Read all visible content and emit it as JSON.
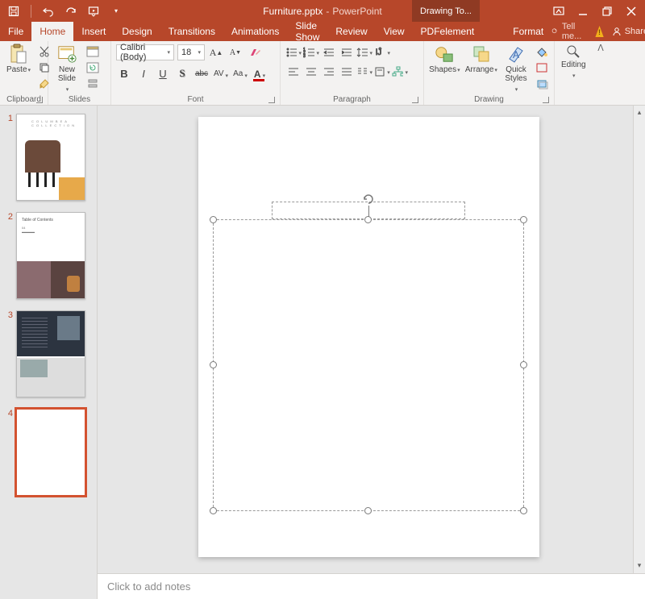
{
  "title": {
    "file": "Furniture.pptx",
    "app": "PowerPoint",
    "toolTab": "Drawing To..."
  },
  "qat": [
    "save",
    "undo",
    "redo",
    "start-from-beginning"
  ],
  "winControls": {
    "displayOptions": "ribbon-display-options",
    "min": "minimize",
    "restore": "restore",
    "close": "close"
  },
  "tabs": [
    "File",
    "Home",
    "Insert",
    "Design",
    "Transitions",
    "Animations",
    "Slide Show",
    "Review",
    "View",
    "PDFelement"
  ],
  "activeTab": 1,
  "contextTab": "Format",
  "tellMe": "Tell me...",
  "share": "Share",
  "ribbon": {
    "clipboard": {
      "label": "Clipboard",
      "paste": "Paste"
    },
    "slides": {
      "label": "Slides",
      "newSlide": "New\nSlide"
    },
    "font": {
      "label": "Font",
      "name": "Calibri (Body)",
      "size": "18"
    },
    "paragraph": {
      "label": "Paragraph"
    },
    "drawing": {
      "label": "Drawing",
      "shapes": "Shapes",
      "arrange": "Arrange",
      "quick": "Quick\nStyles"
    },
    "editing": {
      "label": "Editing",
      "editing": "Editing"
    }
  },
  "thumbs": [
    {
      "n": "1"
    },
    {
      "n": "2"
    },
    {
      "n": "3"
    },
    {
      "n": "4"
    }
  ],
  "selectedThumb": 3,
  "notesPlaceholder": "Click to add notes"
}
